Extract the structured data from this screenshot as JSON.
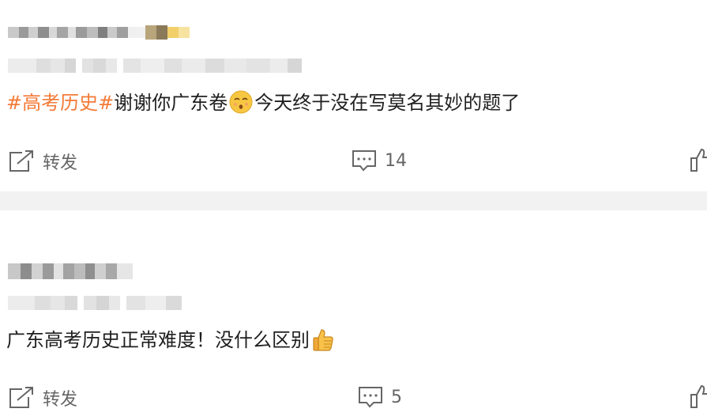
{
  "posts": [
    {
      "text_hashtag": "#高考历史#",
      "text_body_a": "谢谢你广东卷",
      "emoji_1": "kissing-face-emoji",
      "text_body_b": "今天终于没在写莫名其妙的题了",
      "actions": {
        "repost_label": "转发",
        "comment_count": "14"
      }
    },
    {
      "text_body_a": "广东高考历史正常难度！没什么区别",
      "emoji_1": "thumbs-up-emoji",
      "actions": {
        "repost_label": "转发",
        "comment_count": "5"
      }
    }
  ],
  "colors": {
    "hashtag": "#f47a37",
    "separator": "#f2f2f2",
    "icon": "#666666"
  }
}
